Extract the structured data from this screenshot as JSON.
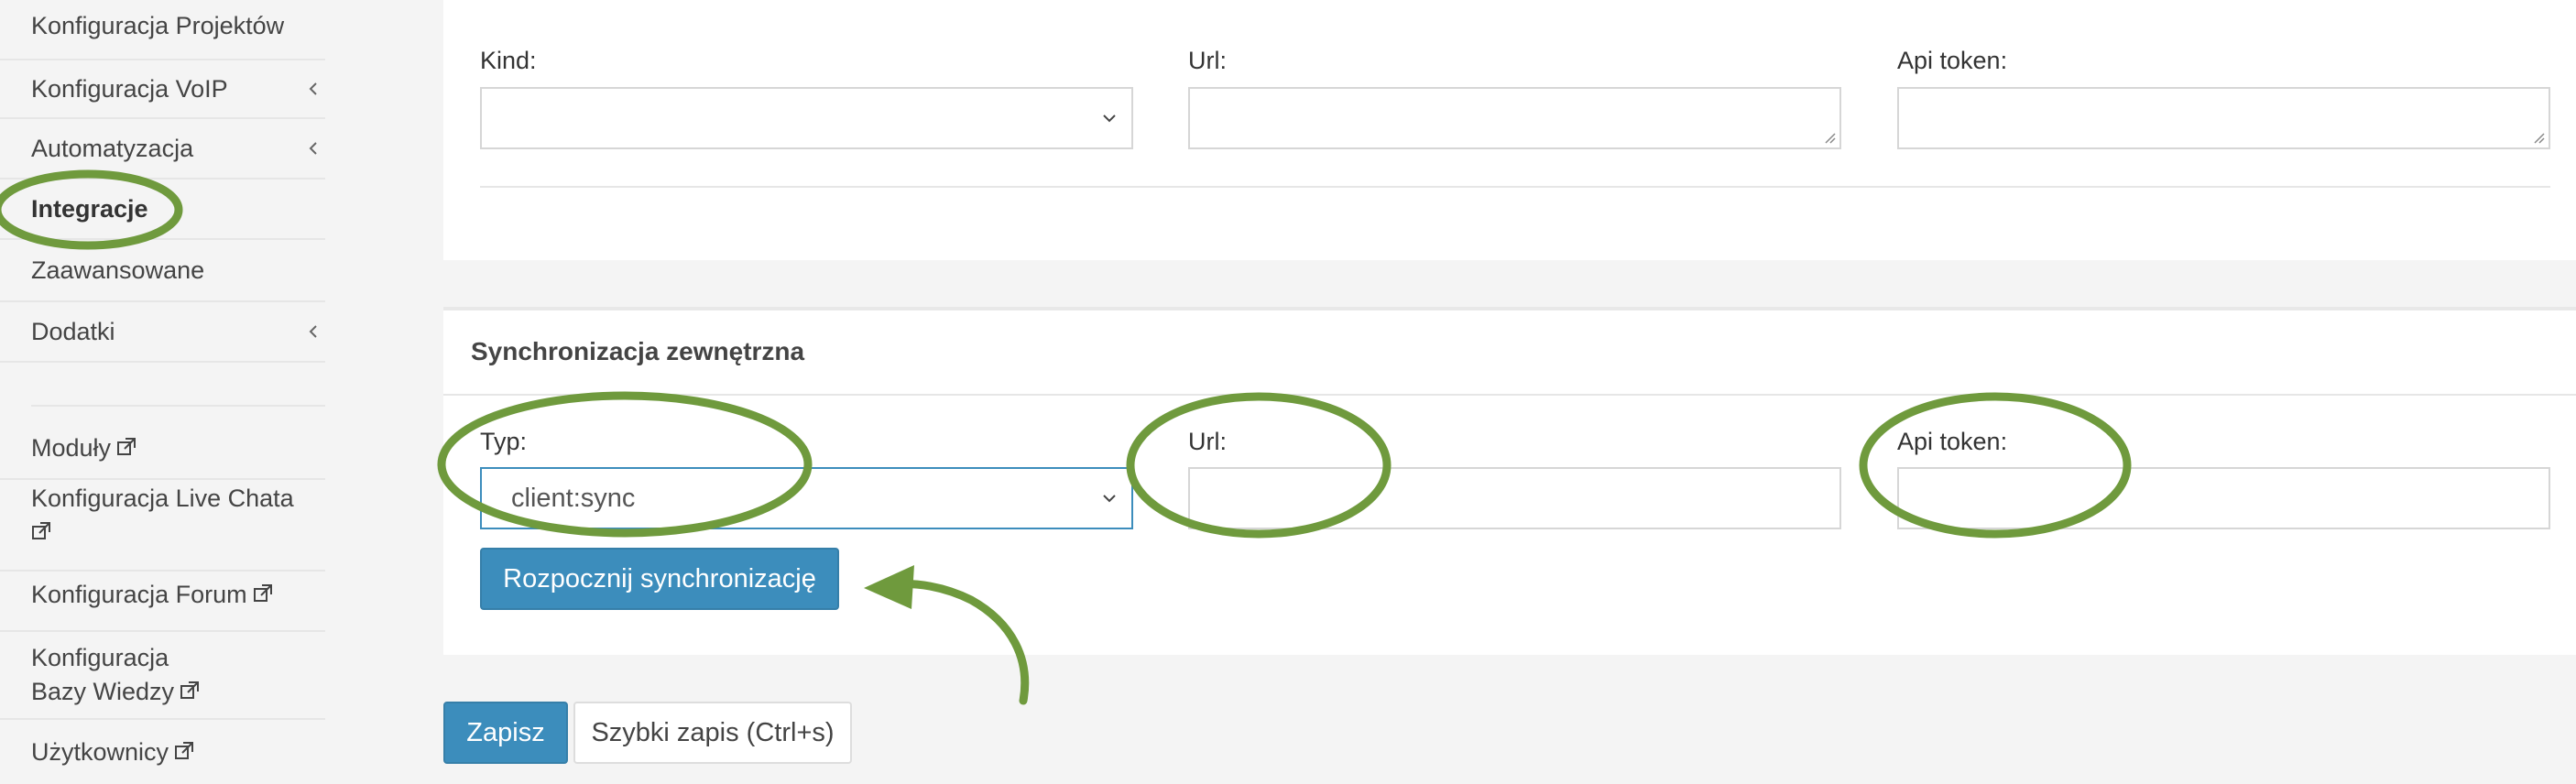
{
  "sidebar": {
    "items": [
      {
        "label": "Konfiguracja Projektów"
      },
      {
        "label": "Konfiguracja VoIP"
      },
      {
        "label": "Automatyzacja"
      },
      {
        "label": "Integracje"
      },
      {
        "label": "Zaawansowane"
      },
      {
        "label": "Dodatki"
      },
      {
        "label": "Moduły"
      },
      {
        "label": "Konfiguracja Live Chata"
      },
      {
        "label": "Konfiguracja Forum"
      },
      {
        "label": "Konfiguracja Bazy Wiedzy"
      },
      {
        "label": "Użytkownicy"
      }
    ],
    "active": "Integracje"
  },
  "top_panel": {
    "kind_label": "Kind:",
    "kind_value": "",
    "url_label": "Url:",
    "url_value": "",
    "api_token_label": "Api token:",
    "api_token_value": ""
  },
  "sync_panel": {
    "title": "Synchronizacja zewnętrzna",
    "type_label": "Typ:",
    "type_value": "client:sync",
    "url_label": "Url:",
    "url_value": "",
    "api_token_label": "Api token:",
    "api_token_value": "",
    "start_button": "Rozpocznij synchronizację"
  },
  "footer": {
    "save_button": "Zapisz",
    "quick_save_button": "Szybki zapis (Ctrl+s)"
  },
  "colors": {
    "primary": "#3c8dbc",
    "annotation": "#6f9a3d",
    "background": "#f4f4f4"
  },
  "icons": {
    "chevron": "chevron-left-icon",
    "external": "external-link-icon",
    "select_caret": "chevron-down-icon"
  }
}
